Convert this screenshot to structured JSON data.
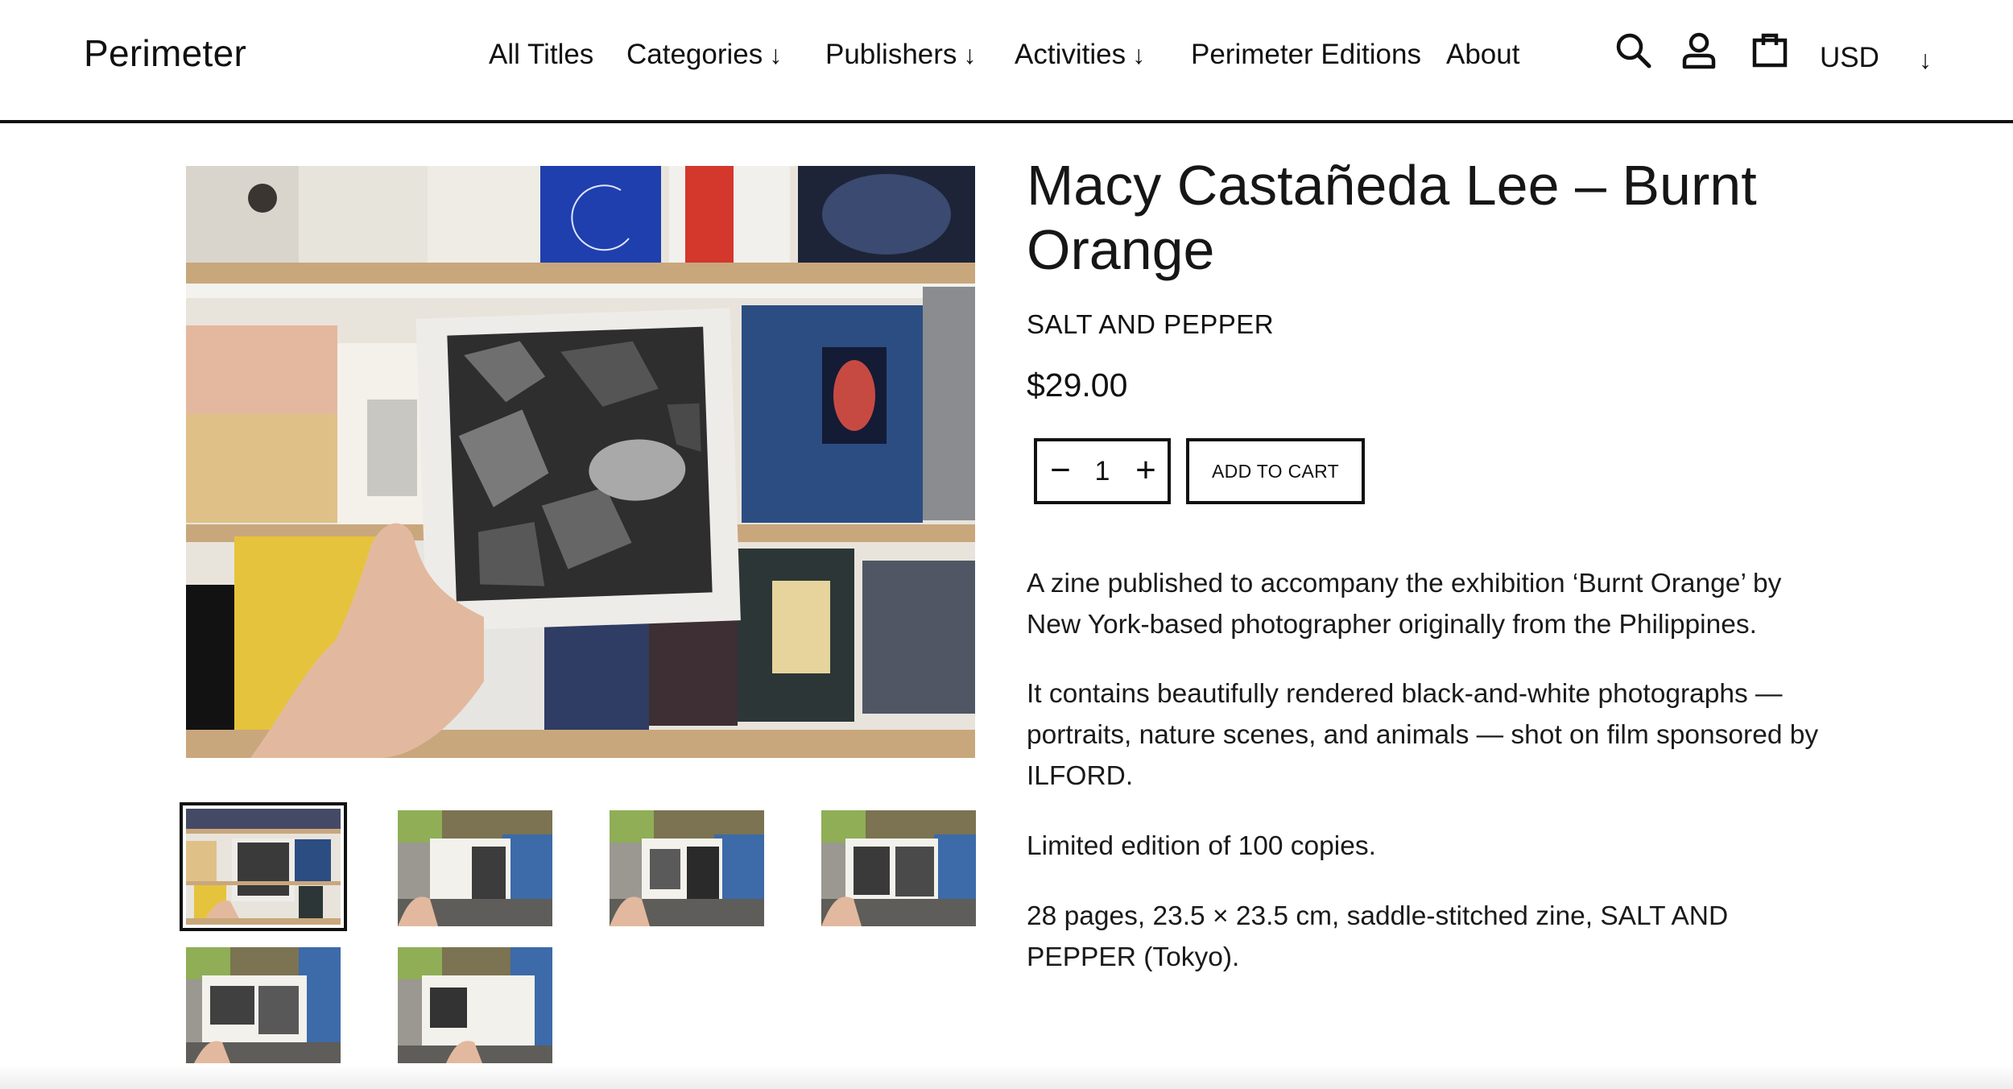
{
  "header": {
    "logo": "Perimeter",
    "nav": [
      {
        "label": "All Titles"
      },
      {
        "label": "Categories"
      },
      {
        "label": "Publishers"
      },
      {
        "label": "Activities"
      },
      {
        "label": "Perimeter Editions"
      },
      {
        "label": "About"
      }
    ],
    "dropdown_arrow": "↓",
    "icons": [
      "search-icon",
      "account-icon",
      "cart-icon"
    ],
    "currency": "USD"
  },
  "gallery": {
    "main_image": "photo: hand holding zine cover of woman lying among rocks in front of bookshelf",
    "thumbnail_count": 6,
    "active_thumbnail": 1
  },
  "product": {
    "title": "Macy Castañeda Lee – Burnt Orange",
    "vendor": "SALT AND PEPPER",
    "price": "$29.00",
    "quantity": "1",
    "minus": "−",
    "plus": "+",
    "add_to_cart": "ADD TO CART",
    "description": [
      "A zine published to accompany the exhibition ‘Burnt Orange’ by  New York-based photographer originally from the Philippines.",
      "It contains beautifully rendered black-and-white photographs — portraits, nature scenes, and animals — shot on film sponsored by ILFORD.",
      "Limited edition of 100 copies.",
      "28 pages, 23.5 × 23.5 cm, saddle-stitched zine, SALT AND PEPPER (Tokyo)."
    ]
  },
  "colors": {
    "text": "#111111",
    "background": "#ffffff"
  }
}
